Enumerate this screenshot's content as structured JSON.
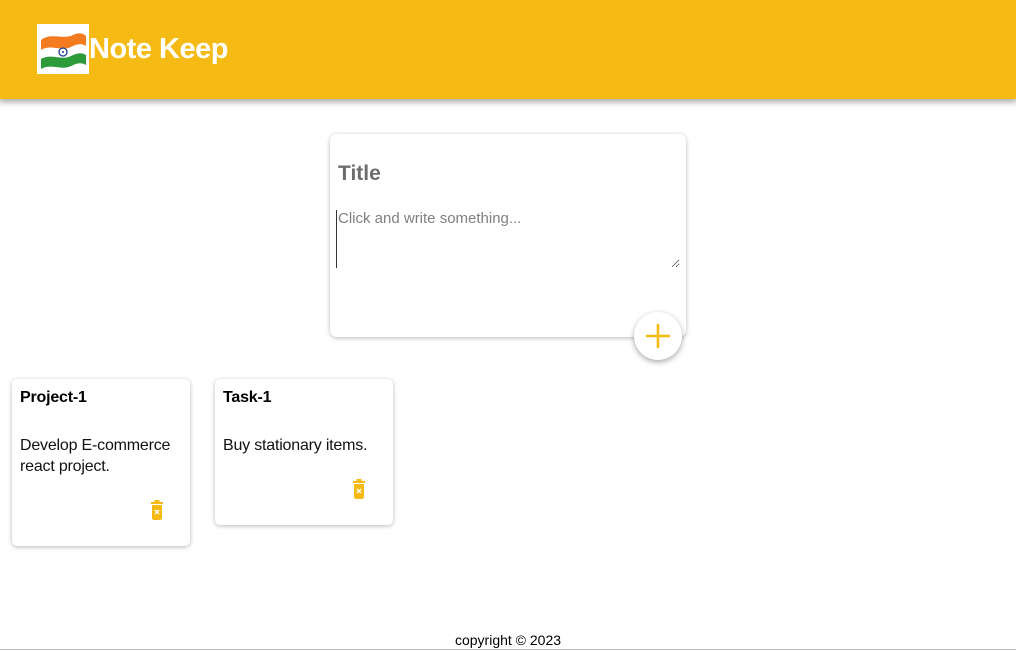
{
  "header": {
    "app_title": "Note Keep",
    "logo_icon": "india-flag-icon",
    "background_color": "#f5ba13"
  },
  "composer": {
    "title_placeholder": "Title",
    "content_placeholder": "Click and write something...",
    "add_icon": "plus-icon"
  },
  "notes": [
    {
      "title": "Project-1",
      "content": "Develop E-commerce react project.",
      "delete_icon": "trash-icon"
    },
    {
      "title": "Task-1",
      "content": "Buy stationary items.",
      "delete_icon": "trash-icon"
    }
  ],
  "footer": {
    "text": "copyright © 2023"
  },
  "colors": {
    "accent": "#f5ba13",
    "card": "#ffffff"
  }
}
